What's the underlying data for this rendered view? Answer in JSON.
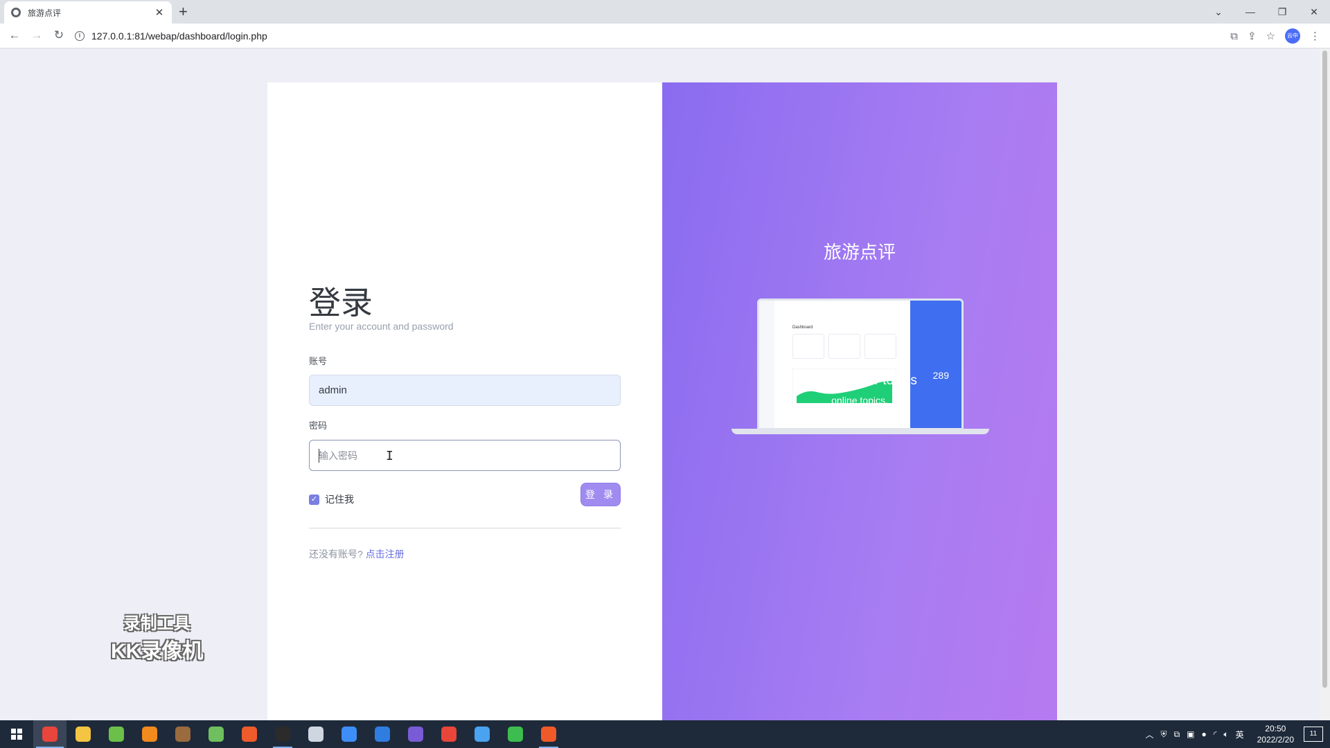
{
  "browser": {
    "tab_title": "旅游点评",
    "tab_close": "✕",
    "new_tab": "+",
    "url": "127.0.0.1:81/webap/dashboard/login.php",
    "profile_label": "云中"
  },
  "login": {
    "title": "登录",
    "subtitle": "Enter your account and password",
    "account_label": "账号",
    "account_value": "admin",
    "password_label": "密码",
    "password_placeholder": "输入密码",
    "remember_label": "记住我",
    "remember_checked": true,
    "submit_label": "登 录",
    "register_prompt": "还没有账号?",
    "register_link": "点击注册"
  },
  "showcase": {
    "brand_title": "旅游点评",
    "heading": "Manage your topics",
    "subheading": "online topics.",
    "mock_dashboard_title": "Dashboard",
    "mock_big_number": "289"
  },
  "watermark": {
    "line1": "录制工具",
    "line2": "KK录像机"
  },
  "taskbar": {
    "time": "20:50",
    "date": "2022/2/20",
    "ime": "英",
    "notifications": "11",
    "apps": [
      {
        "name": "chrome-icon",
        "color": "#e8453c"
      },
      {
        "name": "file-explorer-icon",
        "color": "#f4c542"
      },
      {
        "name": "app-green-icon",
        "color": "#6cc04a"
      },
      {
        "name": "search-app-icon",
        "color": "#f28a1d"
      },
      {
        "name": "game-icon",
        "color": "#9a6b3e"
      },
      {
        "name": "notepad-icon",
        "color": "#6fbf5e"
      },
      {
        "name": "media-player-icon",
        "color": "#ef5b2b"
      },
      {
        "name": "qq-icon",
        "color": "#2b2b2b"
      },
      {
        "name": "settings-icon",
        "color": "#cfd6e0"
      },
      {
        "name": "baidu-netdisk-icon",
        "color": "#3e8ef7"
      },
      {
        "name": "browser-blue-icon",
        "color": "#2f7de1"
      },
      {
        "name": "vs-icon",
        "color": "#7a5bd6"
      },
      {
        "name": "wps-icon",
        "color": "#e8463a"
      },
      {
        "name": "magnifier-icon",
        "color": "#4aa3f0"
      },
      {
        "name": "wechat-icon",
        "color": "#3dbd4f"
      },
      {
        "name": "recorder-icon",
        "color": "#f05a28"
      }
    ]
  }
}
